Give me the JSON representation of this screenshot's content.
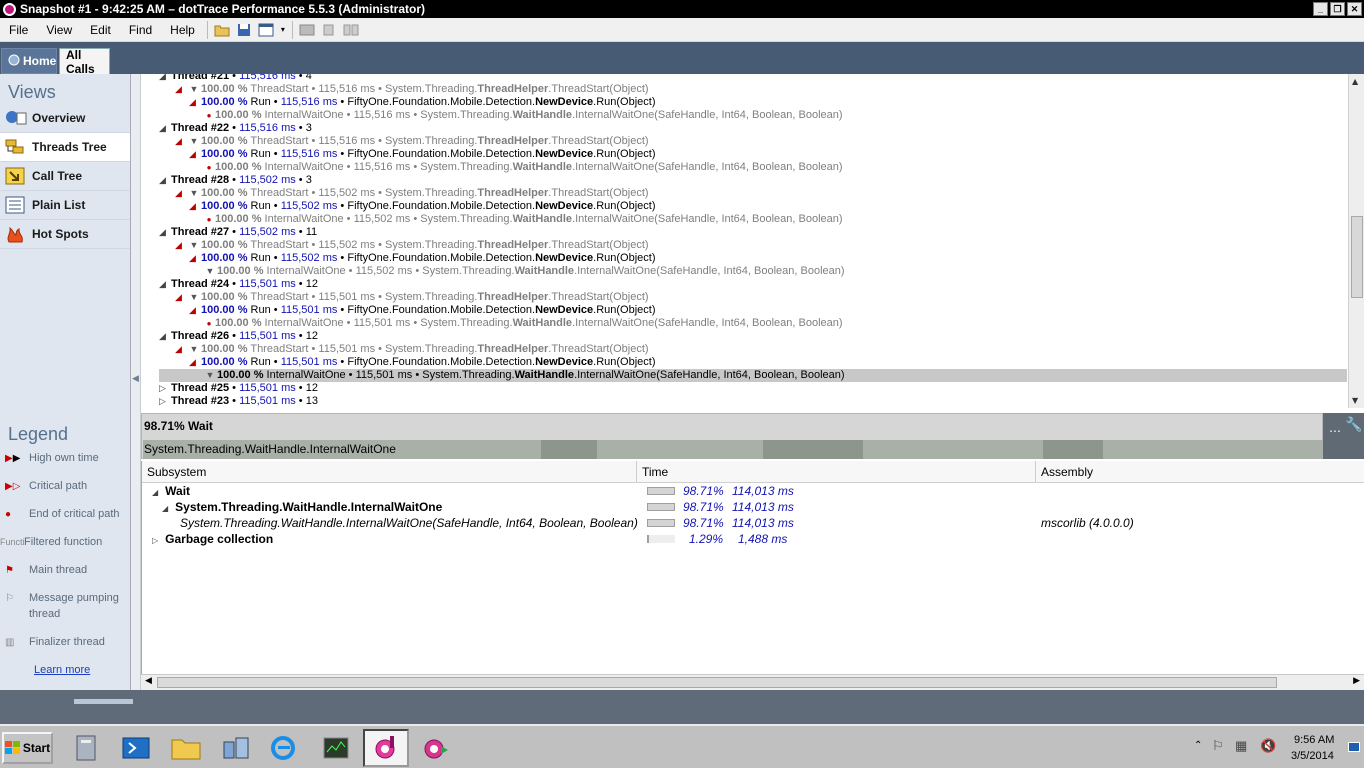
{
  "window": {
    "title": "Snapshot #1 - 9:42:25 AM – dotTrace Performance 5.5.3 (Administrator)"
  },
  "menu": [
    "File",
    "View",
    "Edit",
    "Find",
    "Help"
  ],
  "tabs": {
    "home": "Home",
    "all_calls": "All Calls"
  },
  "sidebar": {
    "views_title": "Views",
    "views": [
      "Overview",
      "Threads Tree",
      "Call Tree",
      "Plain List",
      "Hot Spots"
    ],
    "active_view": "Threads Tree",
    "legend_title": "Legend",
    "legend": [
      {
        "icon": "high-own-time-icon",
        "label": "High own time"
      },
      {
        "icon": "critical-path-icon",
        "label": "Critical path"
      },
      {
        "icon": "end-of-critical-path-icon",
        "label": "End of critical path"
      },
      {
        "icon": "filtered-function-icon",
        "label": "Filtered function",
        "icon_text": "Functi"
      },
      {
        "icon": "main-thread-icon",
        "label": "Main thread"
      },
      {
        "icon": "message-pumping-thread-icon",
        "label": "Message pumping thread"
      },
      {
        "icon": "finalizer-thread-icon",
        "label": "Finalizer thread"
      }
    ],
    "learn_more": "Learn more"
  },
  "tree": {
    "rows": [
      {
        "kind": "thread",
        "name": "Thread #21",
        "time": "115,516 ms",
        "count": "4"
      },
      {
        "kind": "start",
        "pct": "100.00 %",
        "fn": "ThreadStart",
        "time": "115,516 ms",
        "ns": "System.Threading.",
        "cls": "ThreadHelper",
        "meth": ".ThreadStart(Object)"
      },
      {
        "kind": "run",
        "pct": "100.00 %",
        "fn": "Run",
        "time": "115,516 ms",
        "ns": "FiftyOne.Foundation.Mobile.Detection.",
        "cls": "NewDevice",
        "meth": ".Run(Object)"
      },
      {
        "kind": "wait",
        "pct": "100.00 %",
        "fn": "InternalWaitOne",
        "time": "115,516 ms",
        "ns": "System.Threading.",
        "cls": "WaitHandle",
        "meth": ".InternalWaitOne(SafeHandle, Int64, Boolean, Boolean)"
      },
      {
        "kind": "thread",
        "name": "Thread #22",
        "time": "115,516 ms",
        "count": "3"
      },
      {
        "kind": "start",
        "pct": "100.00 %",
        "fn": "ThreadStart",
        "time": "115,516 ms",
        "ns": "System.Threading.",
        "cls": "ThreadHelper",
        "meth": ".ThreadStart(Object)"
      },
      {
        "kind": "run",
        "pct": "100.00 %",
        "fn": "Run",
        "time": "115,516 ms",
        "ns": "FiftyOne.Foundation.Mobile.Detection.",
        "cls": "NewDevice",
        "meth": ".Run(Object)"
      },
      {
        "kind": "wait",
        "pct": "100.00 %",
        "fn": "InternalWaitOne",
        "time": "115,516 ms",
        "ns": "System.Threading.",
        "cls": "WaitHandle",
        "meth": ".InternalWaitOne(SafeHandle, Int64, Boolean, Boolean)"
      },
      {
        "kind": "thread",
        "name": "Thread #28",
        "time": "115,502 ms",
        "count": "3"
      },
      {
        "kind": "start",
        "pct": "100.00 %",
        "fn": "ThreadStart",
        "time": "115,502 ms",
        "ns": "System.Threading.",
        "cls": "ThreadHelper",
        "meth": ".ThreadStart(Object)"
      },
      {
        "kind": "run",
        "pct": "100.00 %",
        "fn": "Run",
        "time": "115,502 ms",
        "ns": "FiftyOne.Foundation.Mobile.Detection.",
        "cls": "NewDevice",
        "meth": ".Run(Object)"
      },
      {
        "kind": "wait",
        "pct": "100.00 %",
        "fn": "InternalWaitOne",
        "time": "115,502 ms",
        "ns": "System.Threading.",
        "cls": "WaitHandle",
        "meth": ".InternalWaitOne(SafeHandle, Int64, Boolean, Boolean)"
      },
      {
        "kind": "thread",
        "name": "Thread #27",
        "time": "115,502 ms",
        "count": "11"
      },
      {
        "kind": "start",
        "pct": "100.00 %",
        "fn": "ThreadStart",
        "time": "115,502 ms",
        "ns": "System.Threading.",
        "cls": "ThreadHelper",
        "meth": ".ThreadStart(Object)"
      },
      {
        "kind": "run",
        "pct": "100.00 %",
        "fn": "Run",
        "time": "115,502 ms",
        "ns": "FiftyOne.Foundation.Mobile.Detection.",
        "cls": "NewDevice",
        "meth": ".Run(Object)"
      },
      {
        "kind": "waitf",
        "pct": "100.00 %",
        "fn": "InternalWaitOne",
        "time": "115,502 ms",
        "ns": "System.Threading.",
        "cls": "WaitHandle",
        "meth": ".InternalWaitOne(SafeHandle, Int64, Boolean, Boolean)"
      },
      {
        "kind": "thread",
        "name": "Thread #24",
        "time": "115,501 ms",
        "count": "12"
      },
      {
        "kind": "start",
        "pct": "100.00 %",
        "fn": "ThreadStart",
        "time": "115,501 ms",
        "ns": "System.Threading.",
        "cls": "ThreadHelper",
        "meth": ".ThreadStart(Object)"
      },
      {
        "kind": "run",
        "pct": "100.00 %",
        "fn": "Run",
        "time": "115,501 ms",
        "ns": "FiftyOne.Foundation.Mobile.Detection.",
        "cls": "NewDevice",
        "meth": ".Run(Object)"
      },
      {
        "kind": "wait",
        "pct": "100.00 %",
        "fn": "InternalWaitOne",
        "time": "115,501 ms",
        "ns": "System.Threading.",
        "cls": "WaitHandle",
        "meth": ".InternalWaitOne(SafeHandle, Int64, Boolean, Boolean)"
      },
      {
        "kind": "thread",
        "name": "Thread #26",
        "time": "115,501 ms",
        "count": "12"
      },
      {
        "kind": "start",
        "pct": "100.00 %",
        "fn": "ThreadStart",
        "time": "115,501 ms",
        "ns": "System.Threading.",
        "cls": "ThreadHelper",
        "meth": ".ThreadStart(Object)"
      },
      {
        "kind": "run",
        "pct": "100.00 %",
        "fn": "Run",
        "time": "115,501 ms",
        "ns": "FiftyOne.Foundation.Mobile.Detection.",
        "cls": "NewDevice",
        "meth": ".Run(Object)"
      },
      {
        "kind": "selwait",
        "pct": "100.00 %",
        "fn": "InternalWaitOne",
        "time": "115,501 ms",
        "ns": "System.Threading.",
        "cls": "WaitHandle",
        "meth": ".InternalWaitOne(SafeHandle, Int64, Boolean, Boolean)"
      },
      {
        "kind": "threadc",
        "name": "Thread #25",
        "time": "115,501 ms",
        "count": "12"
      },
      {
        "kind": "threadc",
        "name": "Thread #23",
        "time": "115,501 ms",
        "count": "13"
      }
    ]
  },
  "detail": {
    "header": "98.71% Wait",
    "path": "System.Threading.WaitHandle.InternalWaitOne"
  },
  "grid": {
    "columns": [
      "Subsystem",
      "Time",
      "Assembly"
    ],
    "rows": [
      {
        "indent": 0,
        "expander": "◢",
        "name": "Wait",
        "bold": true,
        "italic": false,
        "fill": 0.9871,
        "pct": "98.71%",
        "time": "114,013 ms",
        "assembly": ""
      },
      {
        "indent": 1,
        "expander": "◢",
        "name": "System.Threading.WaitHandle.InternalWaitOne",
        "bold": true,
        "italic": false,
        "fill": 0.9871,
        "pct": "98.71%",
        "time": "114,013 ms",
        "assembly": ""
      },
      {
        "indent": 2,
        "expander": "",
        "name": "System.Threading.WaitHandle.InternalWaitOne(SafeHandle, Int64, Boolean, Boolean)",
        "bold": false,
        "italic": true,
        "fill": 0.9871,
        "pct": "98.71%",
        "time": "114,013 ms",
        "assembly": "mscorlib (4.0.0.0)"
      },
      {
        "indent": 0,
        "expander": "▷",
        "name": "Garbage collection",
        "bold": true,
        "italic": false,
        "fill": 0.0129,
        "pct": "1.29%",
        "time": "1,488 ms",
        "assembly": ""
      }
    ]
  },
  "taskbar": {
    "start": "Start",
    "time": "9:56 AM",
    "date": "3/5/2014"
  },
  "colors": {
    "title_bg": "#000000",
    "tab_bg": "#485b74",
    "sidebar_bg": "#dfe6ef",
    "percent_blue": "#1212b4",
    "critical_red": "#c00000"
  }
}
